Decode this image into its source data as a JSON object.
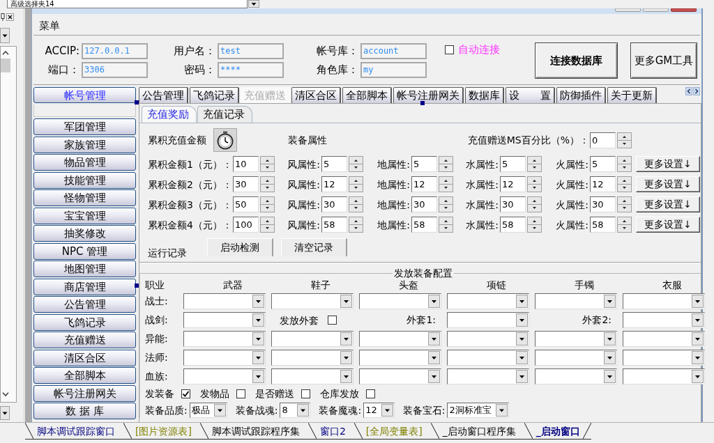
{
  "top_combo": {
    "value": "高级选择夹14"
  },
  "menu": [
    "菜单"
  ],
  "connection": {
    "rows": [
      [
        {
          "label": "ACCIP:",
          "value": "127.0.0.1"
        },
        {
          "label": "用户名：",
          "value": "test"
        },
        {
          "label": "帐号库：",
          "value": "account"
        }
      ],
      [
        {
          "label": "端口：",
          "value": "3306"
        },
        {
          "label": "密码：",
          "value": "****"
        },
        {
          "label": "角色库：",
          "value": "my"
        }
      ]
    ],
    "auto_connect": {
      "label": "自动连接",
      "checked": false
    },
    "buttons": [
      {
        "label": "连接数据库",
        "kind": "primary"
      },
      {
        "label": "更多GM工具",
        "kind": "normal"
      }
    ]
  },
  "nav": {
    "header": "帐号管理",
    "items": [
      "军团管理",
      "家族管理",
      "物品管理",
      "技能管理",
      "怪物管理",
      "宝宝管理",
      "抽奖修改",
      "NPC 管理",
      "地图管理",
      "商店管理",
      "公告管理",
      "飞鸽记录",
      "充值赠送",
      "清区合区",
      "全部脚本",
      "帐号注册网关",
      "数 据 库"
    ]
  },
  "tabs": [
    {
      "label": "公告管理",
      "selected": false
    },
    {
      "label": "飞鸽记录",
      "selected": false
    },
    {
      "label": "充值赠送",
      "selected": true
    },
    {
      "label": "清区合区",
      "selected": false
    },
    {
      "label": "全部脚本",
      "selected": false
    },
    {
      "label": "帐号注册网关",
      "selected": false
    },
    {
      "label": "数据库",
      "selected": false
    },
    {
      "label": "设　　置",
      "selected": false
    },
    {
      "label": "防御插件",
      "selected": false
    },
    {
      "label": "关于更新",
      "selected": false
    }
  ],
  "subtabs": [
    {
      "label": "充值奖励",
      "selected": true
    },
    {
      "label": "充值记录",
      "selected": false
    }
  ],
  "recharge": {
    "total_label": "累积充值金额",
    "attributes_label": "装备属性",
    "ms_percent": {
      "label": "充值赠送MS百分比（%）：",
      "value": "0"
    },
    "tiers": [
      {
        "label": "累积金额1（元）：",
        "amount": "10",
        "attributes": [
          {
            "label": "风属性:",
            "value": "5"
          },
          {
            "label": "地属性:",
            "value": "5"
          },
          {
            "label": "水属性:",
            "value": "5"
          },
          {
            "label": "火属性:",
            "value": "5"
          }
        ],
        "button": "更多设置↓"
      },
      {
        "label": "累积金额2（元）：",
        "amount": "30",
        "attributes": [
          {
            "label": "风属性:",
            "value": "12"
          },
          {
            "label": "地属性:",
            "value": "12"
          },
          {
            "label": "水属性:",
            "value": "12"
          },
          {
            "label": "火属性:",
            "value": "12"
          }
        ],
        "button": "更多设置↓"
      },
      {
        "label": "累积金额3（元）：",
        "amount": "50",
        "attributes": [
          {
            "label": "风属性:",
            "value": "30"
          },
          {
            "label": "地属性:",
            "value": "30"
          },
          {
            "label": "水属性:",
            "value": "30"
          },
          {
            "label": "火属性:",
            "value": "30"
          }
        ],
        "button": "更多设置↓"
      },
      {
        "label": "累积金额4（元）：",
        "amount": "100",
        "attributes": [
          {
            "label": "风属性:",
            "value": "58"
          },
          {
            "label": "地属性:",
            "value": "58"
          },
          {
            "label": "水属性:",
            "value": "58"
          },
          {
            "label": "火属性:",
            "value": "58"
          }
        ],
        "button": "更多设置↓"
      }
    ],
    "log_label": "运行记录",
    "log_buttons": [
      "启动检测",
      "清空记录"
    ]
  },
  "equipment": {
    "title": "发放装备配置",
    "columns": [
      "职业",
      "武器",
      "鞋子",
      "头盔",
      "项链",
      "手镯",
      "衣服"
    ],
    "rows": [
      {
        "kind": "slots",
        "label": "战士:"
      },
      {
        "kind": "coat",
        "label": "战剑:",
        "coat_toggle": {
          "label": "发放外套",
          "checked": false
        },
        "coat_1": "外套1:",
        "coat_2": "外套2:"
      },
      {
        "kind": "slots",
        "label": "异能:"
      },
      {
        "kind": "slots",
        "label": "法师:"
      },
      {
        "kind": "slots",
        "label": "血族:"
      }
    ],
    "options": [
      {
        "label": "发装备",
        "checked": true
      },
      {
        "label": "发物品",
        "checked": false
      },
      {
        "label": "是否赠送",
        "checked": false
      },
      {
        "label": "仓库发放",
        "checked": false
      }
    ],
    "selects": [
      {
        "label": "装备品质:",
        "value": "极品"
      },
      {
        "label": "装备战魂:",
        "value": "8"
      },
      {
        "label": "装备魔魂:",
        "value": "12"
      },
      {
        "label": "装备宝石:",
        "value": "2洞标准宝"
      }
    ]
  },
  "bottom_tabs": [
    {
      "label": "脚本调试跟踪窗口",
      "color": "#000080",
      "selected": false
    },
    {
      "label": "[图片资源表]",
      "color": "#808000",
      "selected": false
    },
    {
      "label": "脚本调试跟踪程序集",
      "color": "#000000",
      "selected": false
    },
    {
      "label": "窗口2",
      "color": "#000080",
      "selected": false
    },
    {
      "label": "[全局变量表]",
      "color": "#808000",
      "selected": false
    },
    {
      "label": "_启动窗口程序集",
      "color": "#000000",
      "selected": false
    },
    {
      "label": "_启动窗口",
      "color": "#000080",
      "selected": true
    }
  ]
}
